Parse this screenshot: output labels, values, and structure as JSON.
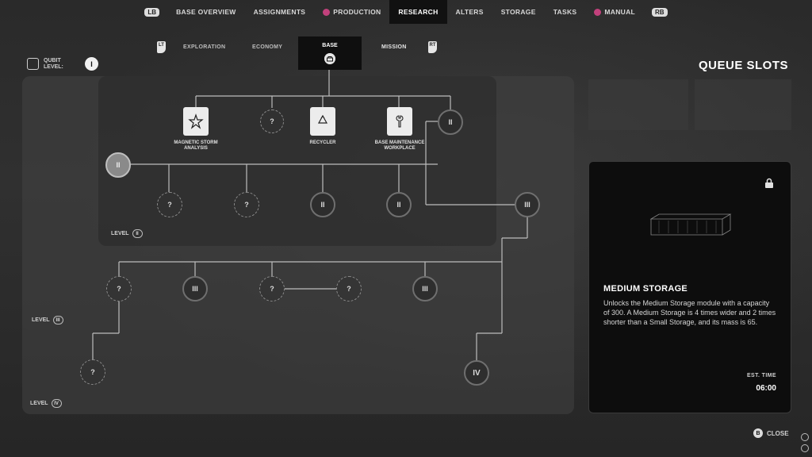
{
  "topnav": {
    "left_bumper": "LB",
    "right_bumper": "RB",
    "items": [
      {
        "label": "BASE OVERVIEW",
        "dot": false,
        "active": false
      },
      {
        "label": "ASSIGNMENTS",
        "dot": false,
        "active": false
      },
      {
        "label": "PRODUCTION",
        "dot": true,
        "active": false
      },
      {
        "label": "RESEARCH",
        "dot": false,
        "active": true
      },
      {
        "label": "ALTERS",
        "dot": false,
        "active": false
      },
      {
        "label": "STORAGE",
        "dot": false,
        "active": false
      },
      {
        "label": "TASKS",
        "dot": false,
        "active": false
      },
      {
        "label": "MANUAL",
        "dot": true,
        "active": false
      }
    ],
    "accent_color": "#c2417c"
  },
  "subtabs": {
    "left_trigger": "LT",
    "right_trigger": "RT",
    "exploration": "EXPLORATION",
    "economy": "ECONOMY",
    "base": "BASE",
    "mission": "MISSION"
  },
  "qubit": {
    "label": "QUBIT LEVEL:",
    "level": "I"
  },
  "queue": {
    "title": "QUEUE SLOTS"
  },
  "tree": {
    "level2": {
      "label": "LEVEL",
      "badge": "II"
    },
    "level3": {
      "label": "LEVEL",
      "badge": "III"
    },
    "level4": {
      "label": "LEVEL",
      "badge": "IV"
    },
    "unknown_mark": "?",
    "cards": [
      {
        "caption": "MAGNETIC STORM ANALYSIS",
        "icon": "storm-star-icon"
      },
      {
        "caption": "RECYCLER",
        "icon": "recycle-icon"
      },
      {
        "caption": "BASE MAINTENANCE WORKPLACE",
        "icon": "wrench-icon"
      }
    ],
    "roman": {
      "ii": "II",
      "iii": "III",
      "iv": "IV"
    }
  },
  "info": {
    "title": "MEDIUM STORAGE",
    "description": "Unlocks the Medium Storage module with a capacity of 300. A Medium Storage is 4 times wider and 2 times shorter than a Small Storage, and its mass is 65.",
    "est_label": "EST. TIME",
    "est_value": "06:00",
    "locked_icon": "lock-icon"
  },
  "footer": {
    "close_button": "B",
    "close_label": "CLOSE"
  }
}
